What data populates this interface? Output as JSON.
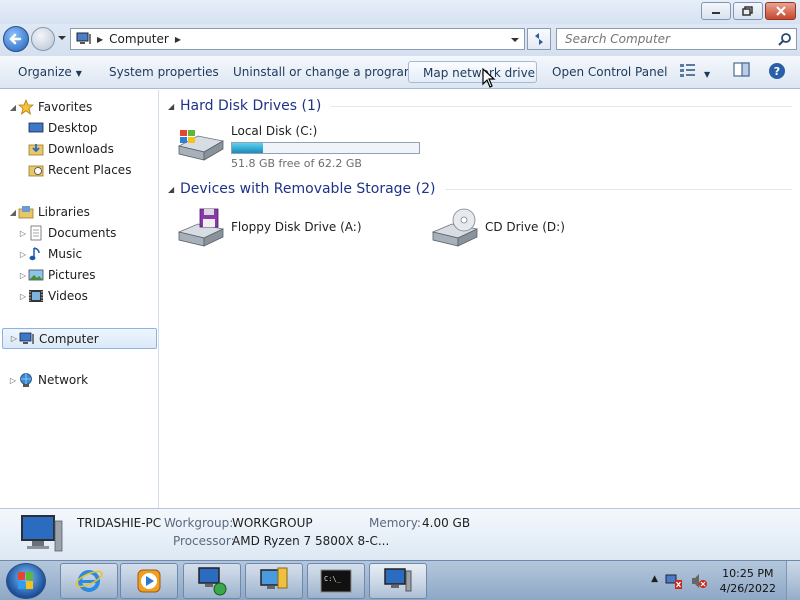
{
  "window": {
    "title_buttons": [
      "minimize-icon",
      "restore-icon",
      "close-icon"
    ]
  },
  "address": {
    "location": "Computer",
    "search_placeholder": "Search Computer"
  },
  "toolbar": {
    "organize": "Organize",
    "system_properties": "System properties",
    "uninstall": "Uninstall or change a program",
    "map_network_drive": "Map network drive",
    "open_control_panel": "Open Control Panel"
  },
  "sidebar": {
    "favorites": "Favorites",
    "desktop": "Desktop",
    "downloads": "Downloads",
    "recent_places": "Recent Places",
    "libraries": "Libraries",
    "documents": "Documents",
    "music": "Music",
    "pictures": "Pictures",
    "videos": "Videos",
    "computer": "Computer",
    "network": "Network"
  },
  "content": {
    "hard_disk_group": "Hard Disk Drives (1)",
    "removable_group": "Devices with Removable Storage (2)",
    "local_disk": {
      "name": "Local Disk (C:)",
      "free": "51.8 GB free of 62.2 GB",
      "used_fraction": 0.167
    },
    "floppy": "Floppy Disk Drive (A:)",
    "cd": "CD Drive (D:)"
  },
  "details": {
    "computer_name": "TRIDASHIE-PC",
    "workgroup_label": "Workgroup:",
    "workgroup_value": "WORKGROUP",
    "memory_label": "Memory:",
    "memory_value": "4.00 GB",
    "processor_label": "Processor:",
    "processor_value": "AMD Ryzen 7 5800X 8-C..."
  },
  "taskbar": {
    "time": "10:25 PM",
    "date": "4/26/2022"
  },
  "colors": {
    "accent": "#1e3287",
    "selection": "#dbe9f8",
    "progress": "#1a8bb8"
  }
}
